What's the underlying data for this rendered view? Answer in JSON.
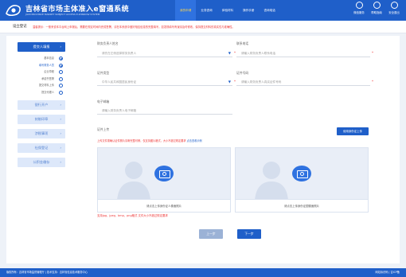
{
  "header": {
    "brand_cn": "吉林省市场主体准入e窗通系统",
    "brand_en": "JILIN PROVINCE MARKET SUBJECT ACCESS E-WINDOW SYSTEM",
    "nav": [
      {
        "label": "我的申请",
        "active": true
      },
      {
        "label": "业务咨询",
        "active": false
      },
      {
        "label": "体验材料",
        "active": false
      },
      {
        "label": "操作手册",
        "active": false
      },
      {
        "label": "咨询电话",
        "active": false
      }
    ],
    "icons": [
      {
        "label": "微信服务",
        "icon": "wechat-icon"
      },
      {
        "label": "帮助指南",
        "icon": "help-icon"
      },
      {
        "label": "安全退出",
        "icon": "power-icon"
      }
    ]
  },
  "subbar": {
    "title": "设立登记",
    "tip": "温馨提示：一般来说本平台网上申报后，需要在规定时间内完成签署，请在本系统中做好相应信息的完整填写，如发现填写有误请及时修改，保持提交材料的真实性与准确性。"
  },
  "sidebar": {
    "main_step": "提交人填报",
    "substeps": [
      {
        "label": "基本信息",
        "state": "done"
      },
      {
        "label": "填写财务人员",
        "state": "current"
      },
      {
        "label": "企业章程",
        "state": "pending"
      },
      {
        "label": "承诺书签署",
        "state": "pending"
      },
      {
        "label": "提交材料上传",
        "state": "pending"
      },
      {
        "label": "提交代理人",
        "state": "pending"
      }
    ],
    "sections": [
      "银行开户",
      "刻制印章",
      "涉税事项",
      "社保登记",
      "公积金缴存"
    ]
  },
  "form": {
    "name_label": "财务负责人姓名",
    "name_placeholder": "请先在左侧选择财务负责人",
    "phone_label": "联系电话",
    "phone_placeholder": "请输入财务负责人联系电话",
    "idtype_label": "证件类型",
    "idtype_placeholder": "中华人民共和国居民身份证",
    "idno_label": "证件号码",
    "idno_placeholder": "请输入财务负责人真实证件号码",
    "email_label": "电子邮箱",
    "email_placeholder": "请输入财务负责人电子邮箱",
    "required_mark": "*"
  },
  "upload": {
    "label": "证件上传",
    "button": "使用身份证上传",
    "tip": "上传文件需确认证件照片清晰完整可辨，仅支持图片格式，大小不超过规定要求",
    "tip_link": "点击查看示例",
    "front_caption": "请点击上传身份证人像面照片",
    "back_caption": "请点击上传身份证国徽面照片",
    "format_tip": "支持jpg，jpeg，bmp，png格式 文件大小不超过规定要求"
  },
  "actions": {
    "prev": "上一步",
    "next": "下一步"
  },
  "footer": {
    "copyright": "版权所有：吉林省市场监督管理厅 | 技术支持：吉林省信息技术服务中心",
    "links": "网站标识码 | 吉ICP备"
  },
  "colors": {
    "primary": "#1f5fc9",
    "warning": "#e33333",
    "panel_bg": "#eef2f8"
  }
}
